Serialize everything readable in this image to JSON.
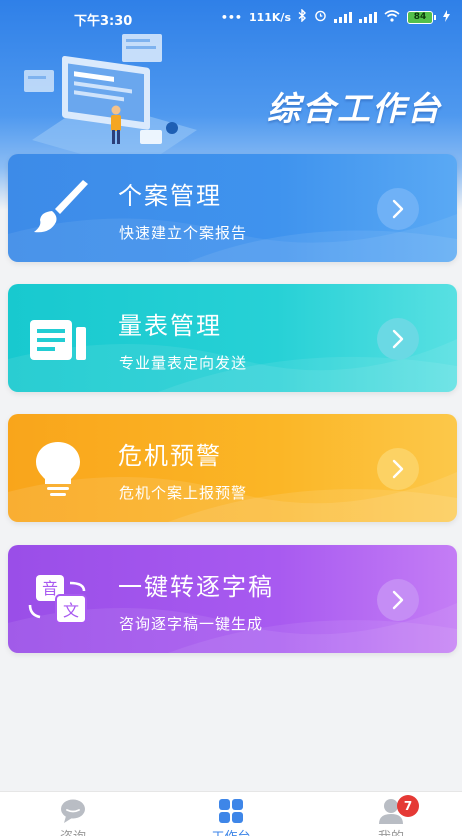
{
  "status_bar": {
    "time": "下午3:30",
    "network_speed": "111K/s",
    "battery": "84"
  },
  "header": {
    "title": "综合工作台"
  },
  "cards": [
    {
      "title": "个案管理",
      "subtitle": "快速建立个案报告",
      "icon": "brush-icon",
      "color": "#3d8be8"
    },
    {
      "title": "量表管理",
      "subtitle": "专业量表定向发送",
      "icon": "form-icon",
      "color": "#18c9cf"
    },
    {
      "title": "危机预警",
      "subtitle": "危机个案上报预警",
      "icon": "lightbulb-icon",
      "color": "#f9a51b"
    },
    {
      "title": "一键转逐字稿",
      "subtitle": "咨询逐字稿一键生成",
      "icon": "translate-icon",
      "color": "#9a4ee8",
      "icon_text": [
        "音",
        "文"
      ]
    }
  ],
  "tabbar": {
    "items": [
      {
        "label": "咨询",
        "icon": "chat-bubble-icon"
      },
      {
        "label": "工作台",
        "icon": "grid-icon",
        "active": true
      },
      {
        "label": "我的",
        "icon": "user-icon",
        "badge": "7"
      }
    ],
    "active_color": "#3e86e8"
  }
}
